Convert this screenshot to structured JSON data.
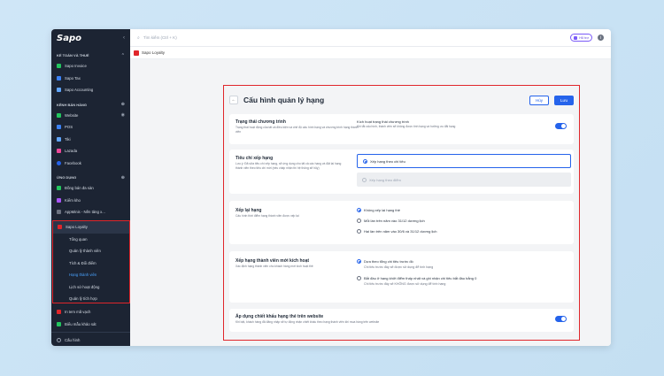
{
  "colors": {
    "accent": "#2563eb",
    "highlight": "#e0262b",
    "sidebar_bg": "#1c2433"
  },
  "sidebar": {
    "logo": "Sapo",
    "sections": [
      {
        "title": "KẾ TOÁN VÀ THUẾ",
        "items": [
          "Sapo Invoice",
          "Sapo Tax",
          "Sapo Accounting"
        ]
      },
      {
        "title": "KÊNH BÁN HÀNG",
        "items": [
          "Website",
          "POS",
          "Tiki",
          "Lazada",
          "Facebook"
        ]
      },
      {
        "title": "ỨNG DỤNG",
        "items": [
          "Đồng bán đa sàn",
          "Kiểm kho",
          "AppMinis - Nền tảng x..."
        ]
      }
    ],
    "loyalty": {
      "label": "Sapo Loyalty",
      "subitems": [
        "Tổng quan",
        "Quản lý thành viên",
        "Tích & Đổi điểm",
        "Hạng thành viên",
        "Lịch sử hoạt động",
        "Quản lý tích hợp"
      ]
    },
    "bottom_items": [
      "In tem mã vạch",
      "Biểu mẫu khảo sát"
    ],
    "footer": "Cấu hình"
  },
  "topbar": {
    "search_placeholder": "Tìm kiếm (Ctrl + K)",
    "help_label": "Hỗ trợ"
  },
  "appbar": {
    "title": "Sapo Loyalty"
  },
  "page": {
    "title": "Cấu hình quản lý hạng",
    "cancel_label": "Hủy",
    "save_label": "Lưu",
    "status": {
      "title": "Trạng thái chương trình",
      "desc": "Trạng thái hoạt động của tất cả điều kiện và chế độ cấu hình hạng và chương trình hạng thành viên",
      "label": "Kích hoạt trạng thái chương trình",
      "label_desc": "Khi tắt cấu hình, thành viên sẽ không được tính hạng và hưởng ưu đãi hạng"
    },
    "criteria": {
      "title": "Tiêu chí xếp hạng",
      "desc": "Lưu ý: Đã sửa tiêu chí xếp hạng, sẽ ứng dụng cho tất cả các hạng và đặt lại hạng thành viên theo tiêu chí mới (nếu chấp nhận thì hệ thống sẽ hủy)",
      "opt1": "Xếp hạng theo chi tiêu",
      "opt2": "Xếp hạng theo điểm"
    },
    "rerank": {
      "title": "Xếp lại hạng",
      "desc": "Cấu hình thời điểm hạng thành viên được xếp lại",
      "opt1": "Không xếp lại hạng thẻ",
      "opt2": "Mỗi lần trên năm vào 31/12 dương lịch",
      "opt3": "Hai lần trên năm vào 30/6 và 31/12 dương lịch"
    },
    "newmember": {
      "title": "Xếp hạng thành viên mới kích hoạt",
      "desc": "Xác định hạng thành viên cho khách hàng mới kích hoạt thẻ",
      "opt1": "Dựa theo tổng chi tiêu trước đó",
      "opt1_sub": "Chi tiêu trước đây sẽ được sử dụng để tính hạng",
      "opt2": "Bắt đầu ở hạng khởi điểm thấp nhất và ghi nhận chi tiêu bắt đầu bằng 0",
      "opt2_sub": "Chi tiêu trước đây sẽ KHÔNG được sử dụng để tính hạng"
    },
    "discount": {
      "title": "Áp dụng chiết khấu hạng thẻ trên website",
      "desc": "Khi bật, khách hàng đã đăng nhập sẽ tự động nhận chiết khấu theo hạng thành viên khi mua hàng trên website"
    }
  }
}
